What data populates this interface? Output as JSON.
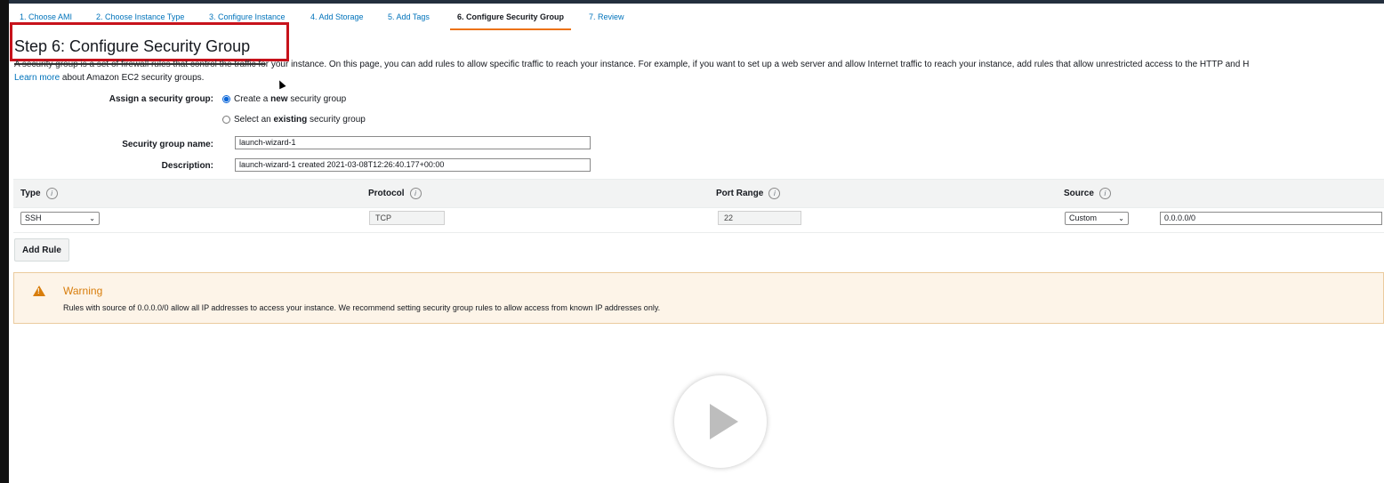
{
  "wizard": {
    "steps": [
      "1. Choose AMI",
      "2. Choose Instance Type",
      "3. Configure Instance",
      "4. Add Storage",
      "5. Add Tags",
      "6. Configure Security Group",
      "7. Review"
    ],
    "active_step": "6. Configure Security Group"
  },
  "page": {
    "title": "Step 6: Configure Security Group",
    "intro_obscured": "A security group is a set of firewall rules that control the traffic fo",
    "intro_rest": "r your instance. On this page, you can add rules to allow specific traffic to reach your instance. For example, if you want to set up a web server and allow Internet traffic to reach your instance, add rules that allow unrestricted access to the HTTP and H",
    "learn_more_link": "Learn more",
    "learn_more_rest": "about Amazon EC2 security groups."
  },
  "assign": {
    "label": "Assign a security group:",
    "create_pre": "Create a ",
    "create_bold": "new",
    "create_post": " security group",
    "existing_pre": "Select an ",
    "existing_bold": "existing",
    "existing_post": " security group",
    "selected": "create"
  },
  "group_name": {
    "label": "Security group name:",
    "value": "launch-wizard-1"
  },
  "description": {
    "label": "Description:",
    "value": "launch-wizard-1 created 2021-03-08T12:26:40.177+00:00"
  },
  "rules_table": {
    "columns": [
      "Type",
      "Protocol",
      "Port Range",
      "Source"
    ],
    "info_glyph": "i",
    "rows": [
      {
        "type": "SSH",
        "protocol": "TCP",
        "port_range": "22",
        "source_mode": "Custom",
        "source_value": "0.0.0.0/0"
      }
    ]
  },
  "add_rule_label": "Add Rule",
  "warning": {
    "title": "Warning",
    "text": "Rules with source of 0.0.0.0/0 allow all IP addresses to access your instance. We recommend setting security group rules to allow access from known IP addresses only."
  },
  "colors": {
    "link": "#0073bb",
    "active_tab_underline": "#ec7211",
    "highlight_box": "#c7121b",
    "warning_accent": "#d87d0b",
    "warning_bg": "#fdf4e8"
  },
  "icons": {
    "warning": "warning-triangle-icon",
    "play": "play-icon",
    "info": "info-icon",
    "chevron": "chevron-down-icon"
  }
}
